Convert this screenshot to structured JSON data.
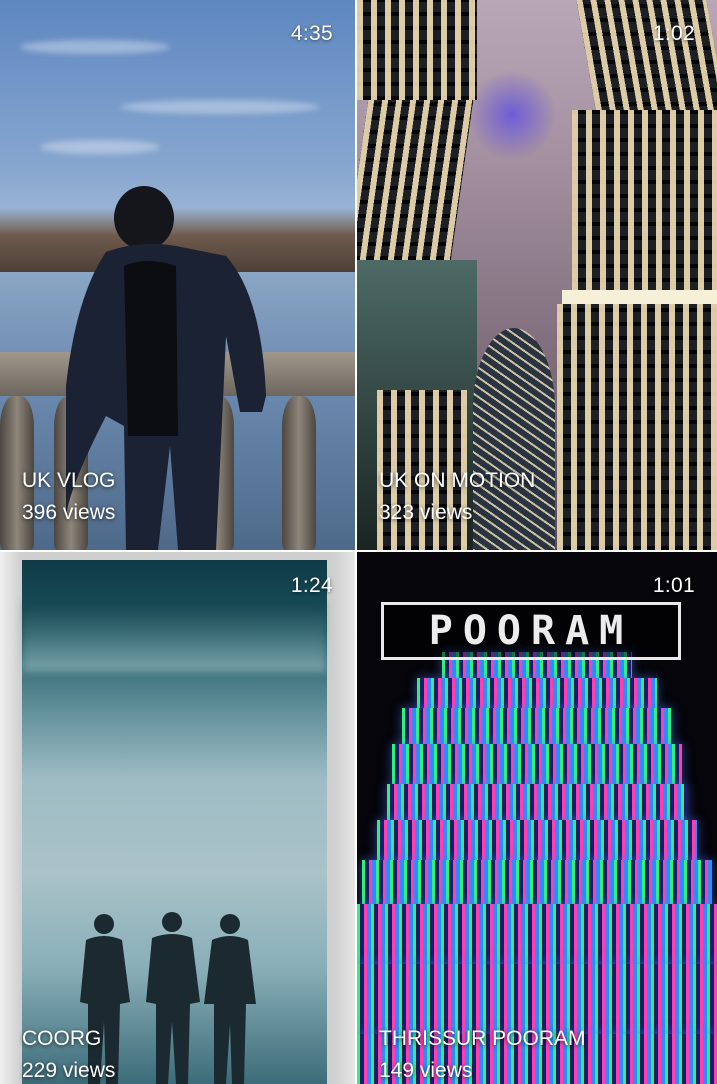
{
  "videos": [
    {
      "title": "UK VLOG",
      "views": "396 views",
      "duration": "4:35"
    },
    {
      "title": "UK ON MOTION",
      "views": "323 views",
      "duration": "1:02"
    },
    {
      "title": "COORG",
      "views": "229 views",
      "duration": "1:24"
    },
    {
      "title": "THRISSUR POORAM",
      "views": "149 views",
      "duration": "1:01",
      "thumbnail_text": "POORAM"
    }
  ]
}
